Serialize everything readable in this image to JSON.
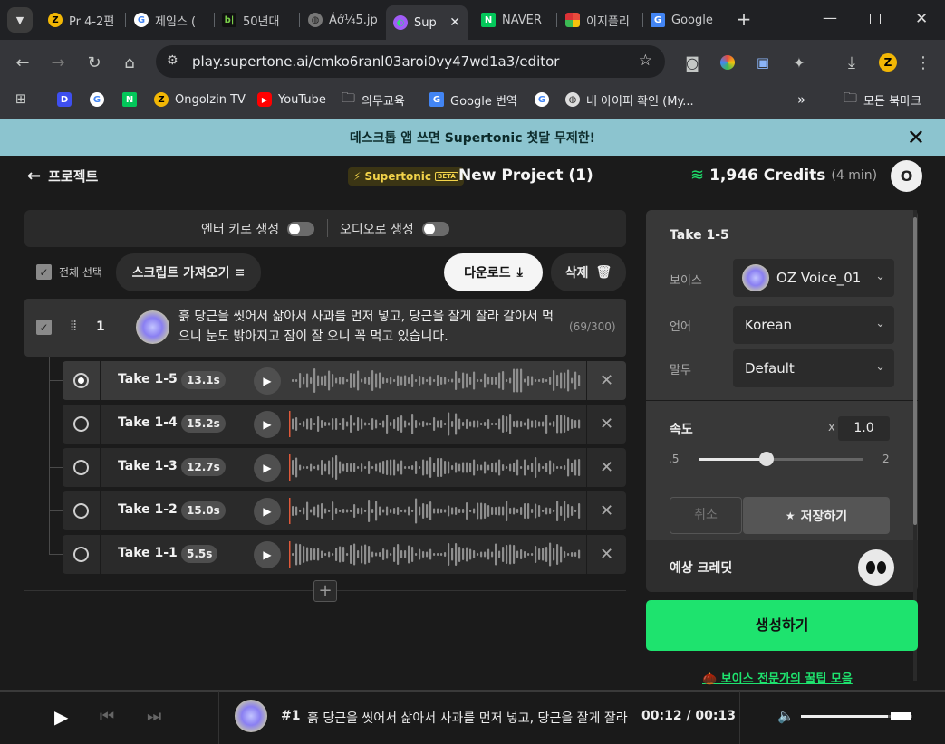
{
  "browser": {
    "tabs": [
      {
        "title": "Pr 4-2편",
        "icon": "zeta-icon"
      },
      {
        "title": "제임스 (",
        "icon": "google-icon"
      },
      {
        "title": "50년대 ",
        "icon": "bl-icon"
      },
      {
        "title": "Áớ¼5.jp",
        "icon": "globe-icon"
      },
      {
        "title": "Sup",
        "icon": "supertone-icon"
      },
      {
        "title": "NAVER",
        "icon": "naver-icon"
      },
      {
        "title": "이지플리",
        "icon": "pinwheel-icon"
      },
      {
        "title": "Google ",
        "icon": "google-translate-icon"
      }
    ],
    "url": "play.supertone.ai/cmko6ranl03aroi0vy47wd1a3/editor",
    "bookmarks": [
      {
        "label": "",
        "icon": "d-icon"
      },
      {
        "label": "",
        "icon": "google-icon"
      },
      {
        "label": "",
        "icon": "naver-icon"
      },
      {
        "label": "Ongolzin TV",
        "icon": "zeta-icon"
      },
      {
        "label": "YouTube",
        "icon": "youtube-icon"
      },
      {
        "label": "의무교육",
        "icon": "folder-icon"
      },
      {
        "label": "Google 번역",
        "icon": "google-translate-icon"
      },
      {
        "label": "",
        "icon": "google-icon"
      },
      {
        "label": "내 아이피 확인 (My...",
        "icon": "globe-icon"
      }
    ],
    "all_bookmarks": "모든 북마크"
  },
  "banner": {
    "text": "데스크톱 앱 쓰면 Supertonic 첫달 무제한!"
  },
  "header": {
    "back_label": "프로젝트",
    "brand": "Supertonic",
    "beta": "BETA",
    "project_title": "New Project (1)",
    "credits": "1,946 Credits",
    "credits_time": "(4 min)",
    "avatar_initial": "O"
  },
  "options": {
    "enter_generate": "엔터 키로 생성",
    "audio_generate": "오디오로 생성"
  },
  "actions": {
    "select_all": "전체 선택",
    "import_script": "스크립트 가져오기",
    "download": "다운로드",
    "delete": "삭제"
  },
  "script": {
    "index": "1",
    "text": "흙 당근을 씻어서 삶아서 사과를 먼저 넣고, 당근을 잘게 잘라 갈아서 먹으니 눈도 밝아지고 잠이 잘 오니 꼭 먹고 있습니다.",
    "count": "(69/300)"
  },
  "takes": [
    {
      "name": "Take 1-5",
      "duration": "13.1s",
      "selected": true
    },
    {
      "name": "Take 1-4",
      "duration": "15.2s",
      "selected": false
    },
    {
      "name": "Take 1-3",
      "duration": "12.7s",
      "selected": false
    },
    {
      "name": "Take 1-2",
      "duration": "15.0s",
      "selected": false
    },
    {
      "name": "Take 1-1",
      "duration": "5.5s",
      "selected": false
    }
  ],
  "panel": {
    "title": "Take 1-5",
    "voice_label": "보이스",
    "voice_value": "OZ Voice_01",
    "language_label": "언어",
    "language_value": "Korean",
    "tone_label": "말투",
    "tone_value": "Default",
    "speed_label": "속도",
    "speed_prefix": "x",
    "speed_value": "1.0",
    "speed_min": ".5",
    "speed_max": "2",
    "speed_fraction": 0.41,
    "cancel": "취소",
    "save": "저장하기",
    "expected_credit": "예상 크레딧",
    "generate": "생성하기",
    "tips": "🌰 보이스 전문가의 꿀팁 모음"
  },
  "player": {
    "track": "#1",
    "text": "흙 당근을 씻어서 삶아서 사과를 먼저 넣고, 당근을 잘게 잘라",
    "time": "00:12 / 00:13",
    "volume_fraction": 0.78
  }
}
